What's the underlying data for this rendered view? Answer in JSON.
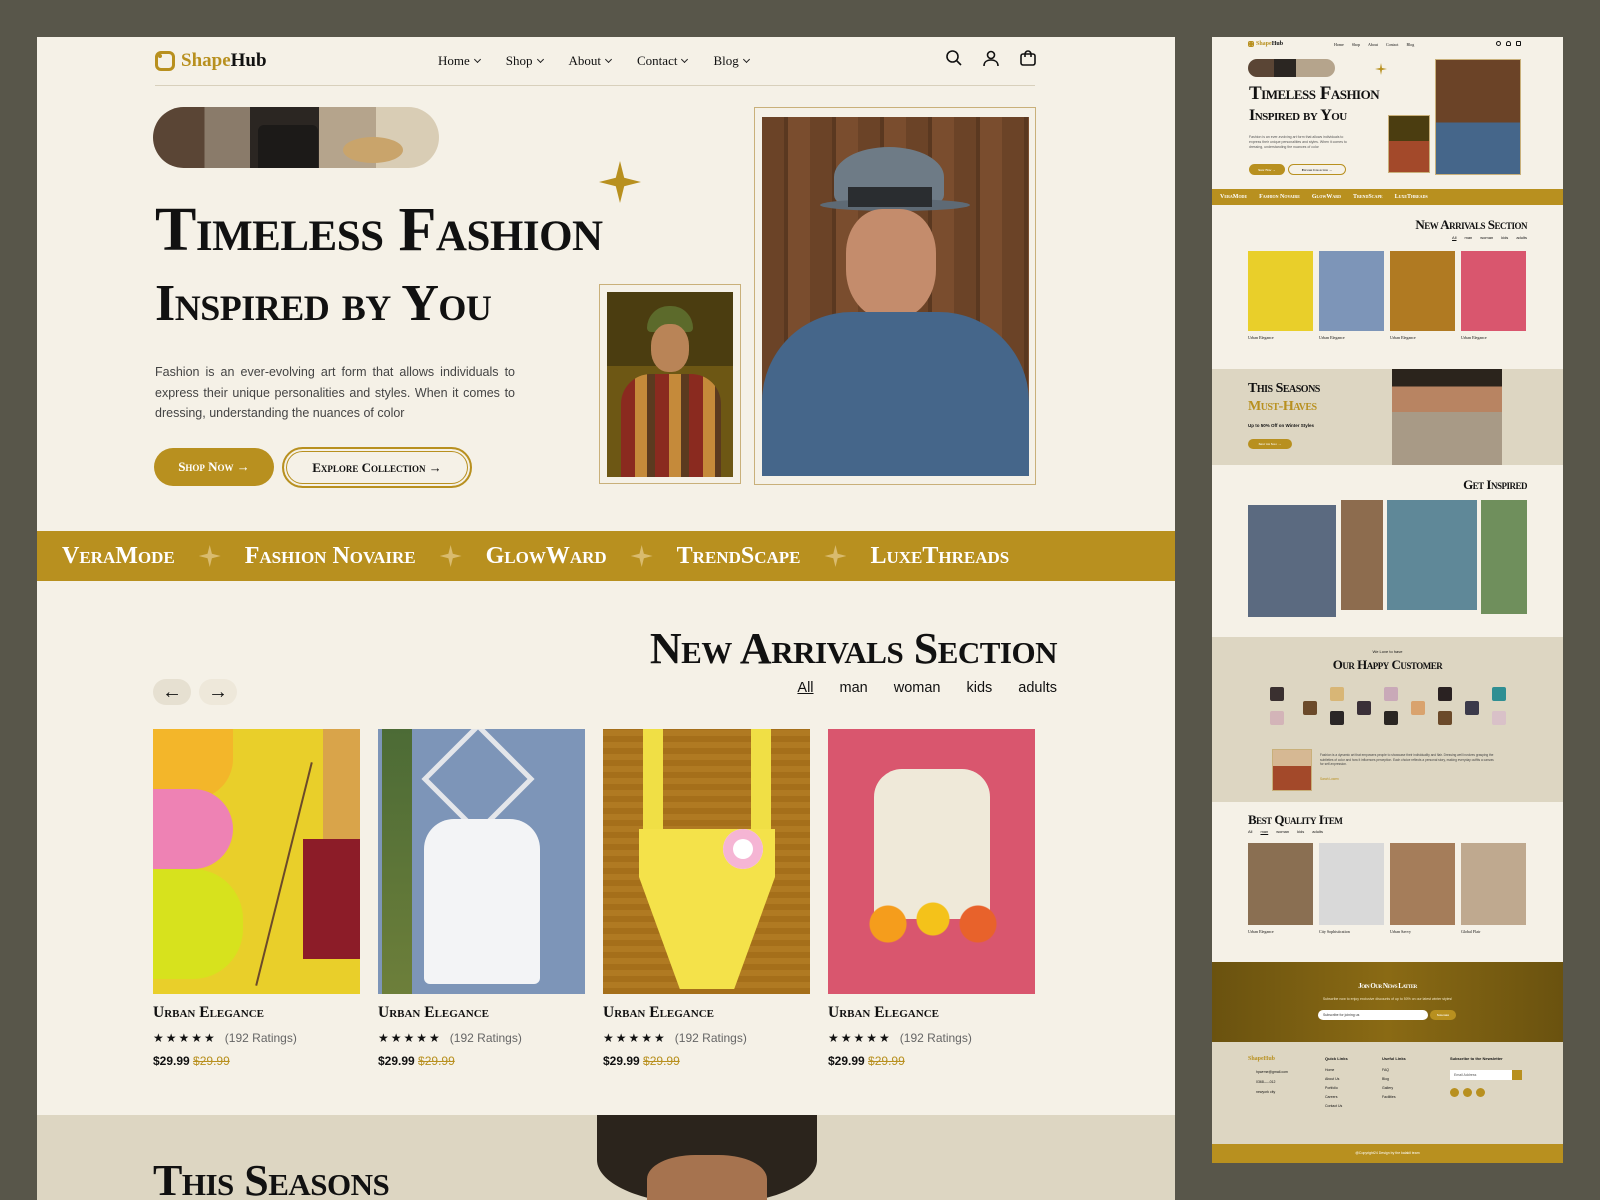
{
  "brand": {
    "name_a": "Shape",
    "name_b": "Hub"
  },
  "nav": [
    "Home",
    "Shop",
    "About",
    "Contact",
    "Blog"
  ],
  "hero": {
    "title_line1": "Timeless Fashion",
    "title_line2": "Inspired by You",
    "body": "Fashion is an ever-evolving art form that allows individuals to express their unique personalities and styles. When it comes to dressing, understanding the nuances of color",
    "shop_now": "Shop Now →",
    "explore": "Explore Collection →"
  },
  "brands": [
    "VeraMode",
    "Fashion Novaire",
    "GlowWard",
    "TrendScape",
    "LuxeThreads"
  ],
  "arrivals": {
    "heading": "New Arrivals Section",
    "tabs": [
      "All",
      "man",
      "woman",
      "kids",
      "adults"
    ],
    "prev": "←",
    "next": "→",
    "products": [
      {
        "name": "Urban Elegance",
        "stars": "★★★★★",
        "ratings": "(192 Ratings)",
        "price": "$29.99",
        "old_price": "$29.99"
      },
      {
        "name": "Urban Elegance",
        "stars": "★★★★★",
        "ratings": "(192 Ratings)",
        "price": "$29.99",
        "old_price": "$29.99"
      },
      {
        "name": "Urban Elegance",
        "stars": "★★★★★",
        "ratings": "(192 Ratings)",
        "price": "$29.99",
        "old_price": "$29.99"
      },
      {
        "name": "Urban Elegance",
        "stars": "★★★★★",
        "ratings": "(192 Ratings)",
        "price": "$29.99",
        "old_price": "$29.99"
      }
    ]
  },
  "season": {
    "heading": "This Seasons",
    "heading_b": "Must-Haves",
    "sub": "Up to 50% Off on Winter Styles",
    "cta": "Shop the Sale →"
  },
  "inspired": {
    "heading": "Get Inspired"
  },
  "customers": {
    "kicker": "We Love to have",
    "heading": "Our Happy Customer",
    "quote": "Fashion is a dynamic art that empowers people to showcase their individuality and flair. Dressing well involves grasping the subtleties of color and how it influences perception. Each choice reflects a personal story, making everyday outfits a canvas for self-expression.",
    "quote_by": "Sarah Lowen"
  },
  "best": {
    "heading": "Best Quality Item",
    "tabs": [
      "All",
      "man",
      "woman",
      "kids",
      "adults"
    ],
    "products": [
      "Urban Elegance",
      "City Sophistication",
      "Urban Savvy",
      "Global Flair"
    ]
  },
  "newsletter": {
    "heading": "Join Our News Latter",
    "sub": "Subscribe now to enjoy exclusive discounts of up to 50% on our latest winter styles!",
    "placeholder": "Subscribe for joining us",
    "button": "Subscribe"
  },
  "footer": {
    "brand": "ShapeHub",
    "contacts": [
      "hpwrme@gmail.com",
      "0368-----012",
      "newyork city"
    ],
    "quick_title": "Quick Links",
    "quick": [
      "Home",
      "About Us",
      "Portfolio",
      "Careers",
      "Contact Us"
    ],
    "useful_title": "Useful Links",
    "useful": [
      "FAQ",
      "Blog",
      "Gallery",
      "Facilities"
    ],
    "sub_title": "Subscribe to the Newsletter",
    "email_placeholder": "Email Address",
    "copyright": "@Copyright24 Design by the kalakil team"
  },
  "colors": {
    "accent": "#b8901f",
    "bg": "#f5f1e7",
    "outer": "#58564a"
  }
}
